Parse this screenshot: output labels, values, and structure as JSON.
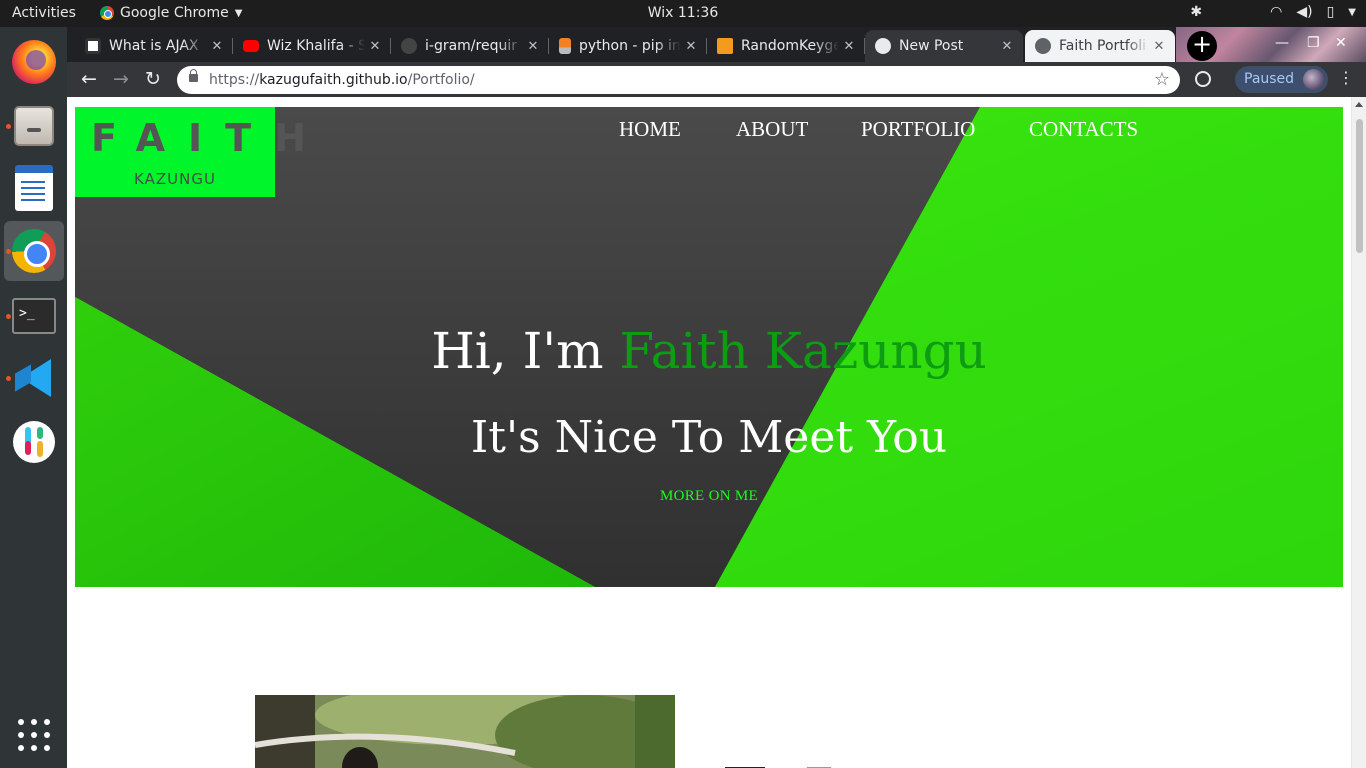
{
  "system": {
    "activities": "Activities",
    "app_name": "Google Chrome",
    "clock": "Wix 11:36"
  },
  "browser": {
    "tabs": [
      {
        "title": "What is AJAX",
        "favicon": "ajax-favicon"
      },
      {
        "title": "Wiz Khalifa - S",
        "favicon": "youtube-favicon"
      },
      {
        "title": "i-gram/requir",
        "favicon": "github-favicon"
      },
      {
        "title": "python - pip in",
        "favicon": "stackoverflow-favicon"
      },
      {
        "title": "RandomKeyge",
        "favicon": "randomkeygen-favicon"
      },
      {
        "title": "New Post",
        "favicon": "globe-favicon"
      },
      {
        "title": "Faith Portfoli",
        "favicon": "globe-favicon"
      }
    ],
    "active_tab_index": 6,
    "url": {
      "scheme": "https://",
      "host": "kazugufaith.github.io",
      "path": "/Portfolio/"
    },
    "profile_status": "Paused"
  },
  "dock": {
    "items": [
      "firefox",
      "files",
      "libreoffice-writer",
      "chrome",
      "terminal",
      "vscode",
      "slack"
    ],
    "terminal_glyph": ">_"
  },
  "site": {
    "logo": {
      "line1": "FAITH",
      "line2": "KAZUNGU"
    },
    "nav": [
      "HOME",
      "ABOUT",
      "PORTFOLIO",
      "CONTACTS"
    ],
    "greeting": {
      "prefix": "Hi, I'm ",
      "name": "Faith Kazungu"
    },
    "tagline": "It's Nice To Meet You",
    "cta": "MORE ON ME",
    "colors": {
      "accent_green": "#00f62a",
      "name_green": "#0d9d12",
      "cta_green": "#19ff1f",
      "hero_dark": "#3a3a3a"
    }
  }
}
